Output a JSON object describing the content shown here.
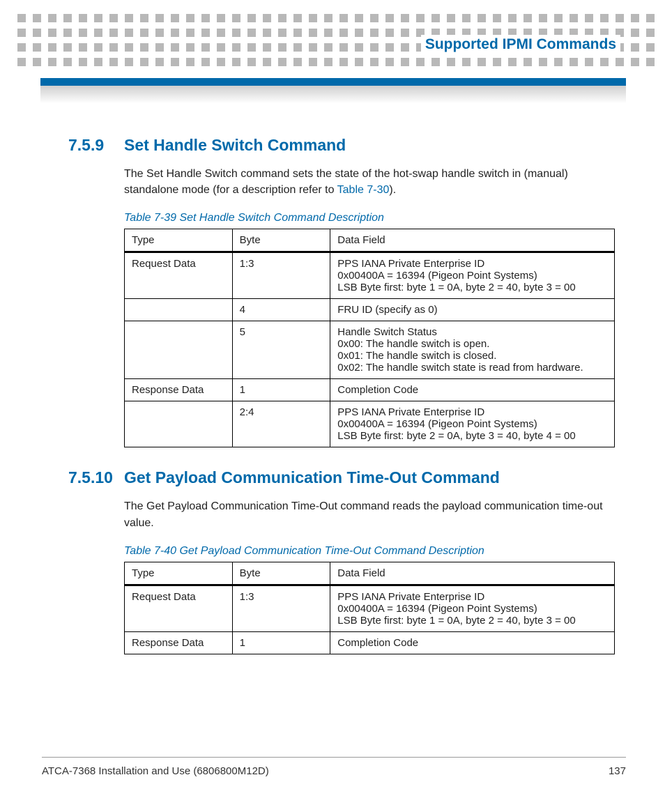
{
  "header": {
    "chapter_title": "Supported IPMI Commands"
  },
  "sections": [
    {
      "number": "7.5.9",
      "title": "Set Handle Switch Command",
      "intro_pre": "The Set Handle Switch command sets the state of the hot-swap handle switch in (manual) standalone mode (for a description refer to ",
      "intro_link": "Table 7-30",
      "intro_post": ").",
      "table_caption": "Table 7-39 Set Handle Switch Command Description",
      "table": {
        "headers": [
          "Type",
          "Byte",
          "Data Field"
        ],
        "rows": [
          {
            "type": "Request Data",
            "byte": "1:3",
            "data": "PPS IANA Private Enterprise ID\n0x00400A = 16394 (Pigeon Point Systems)\nLSB Byte first: byte 1 = 0A, byte 2 = 40, byte 3 = 00"
          },
          {
            "type": "",
            "byte": "4",
            "data": "FRU ID (specify as 0)"
          },
          {
            "type": "",
            "byte": "5",
            "data": "Handle Switch Status\n0x00: The handle switch is open.\n0x01: The handle switch is closed.\n0x02: The handle switch state is read from hardware."
          },
          {
            "type": "Response Data",
            "byte": "1",
            "data": "Completion Code"
          },
          {
            "type": "",
            "byte": "2:4",
            "data": "PPS IANA Private Enterprise ID\n0x00400A = 16394 (Pigeon Point Systems)\nLSB Byte first: byte 2 = 0A, byte 3 = 40, byte 4 = 00"
          }
        ]
      }
    },
    {
      "number": "7.5.10",
      "title": "Get Payload Communication Time-Out Command",
      "intro_pre": "The Get Payload Communication Time-Out command reads the payload communication time-out value.",
      "intro_link": "",
      "intro_post": "",
      "table_caption": "Table 7-40 Get Payload Communication Time-Out Command Description",
      "table": {
        "headers": [
          "Type",
          "Byte",
          "Data Field"
        ],
        "rows": [
          {
            "type": "Request Data",
            "byte": "1:3",
            "data": "PPS IANA Private Enterprise ID\n0x00400A = 16394 (Pigeon Point Systems)\nLSB Byte first: byte 1 = 0A, byte 2 = 40, byte 3 = 00"
          },
          {
            "type": "Response Data",
            "byte": "1",
            "data": "Completion Code"
          }
        ]
      }
    }
  ],
  "footer": {
    "doc_title": "ATCA-7368 Installation and Use (6806800M12D)",
    "page_number": "137"
  }
}
